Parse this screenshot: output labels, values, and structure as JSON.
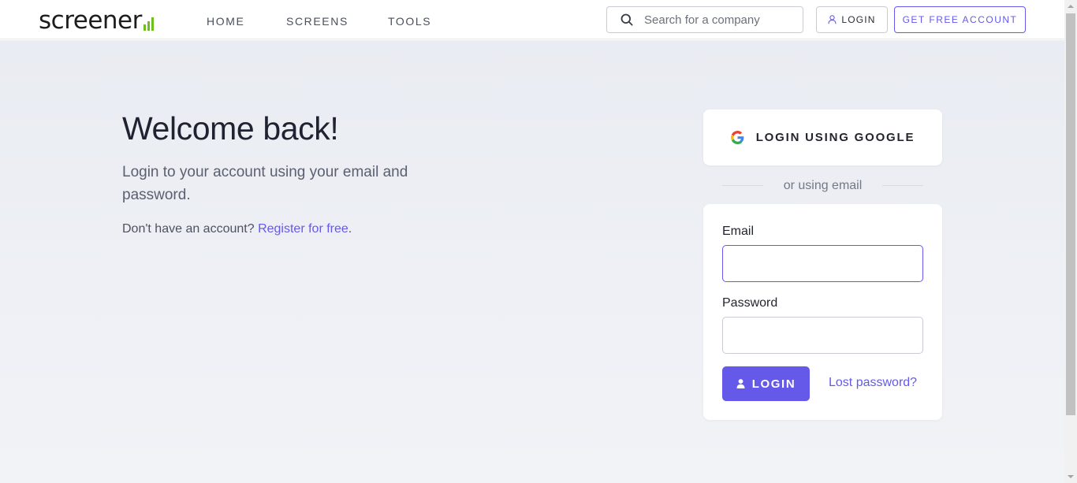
{
  "header": {
    "logo_text": "screener",
    "nav": [
      {
        "label": "HOME"
      },
      {
        "label": "SCREENS"
      },
      {
        "label": "TOOLS"
      }
    ],
    "search": {
      "placeholder": "Search for a company",
      "icon": "search-icon"
    },
    "login_label": "LOGIN",
    "free_account_label": "GET FREE ACCOUNT"
  },
  "main": {
    "title": "Welcome back!",
    "subtitle": "Login to your account using your email and password.",
    "register_prefix": "Don't have an account?",
    "register_link": "Register for free",
    "register_suffix": "."
  },
  "login_form": {
    "google_label": "LOGIN USING GOOGLE",
    "divider_text": "or using email",
    "email_label": "Email",
    "email_value": "",
    "password_label": "Password",
    "password_value": "",
    "submit_label": "LOGIN",
    "lost_password_label": "Lost password?"
  },
  "colors": {
    "accent": "#6559e9",
    "logo_green": "#6cbf1e",
    "page_bg": "#e9ecf2"
  }
}
